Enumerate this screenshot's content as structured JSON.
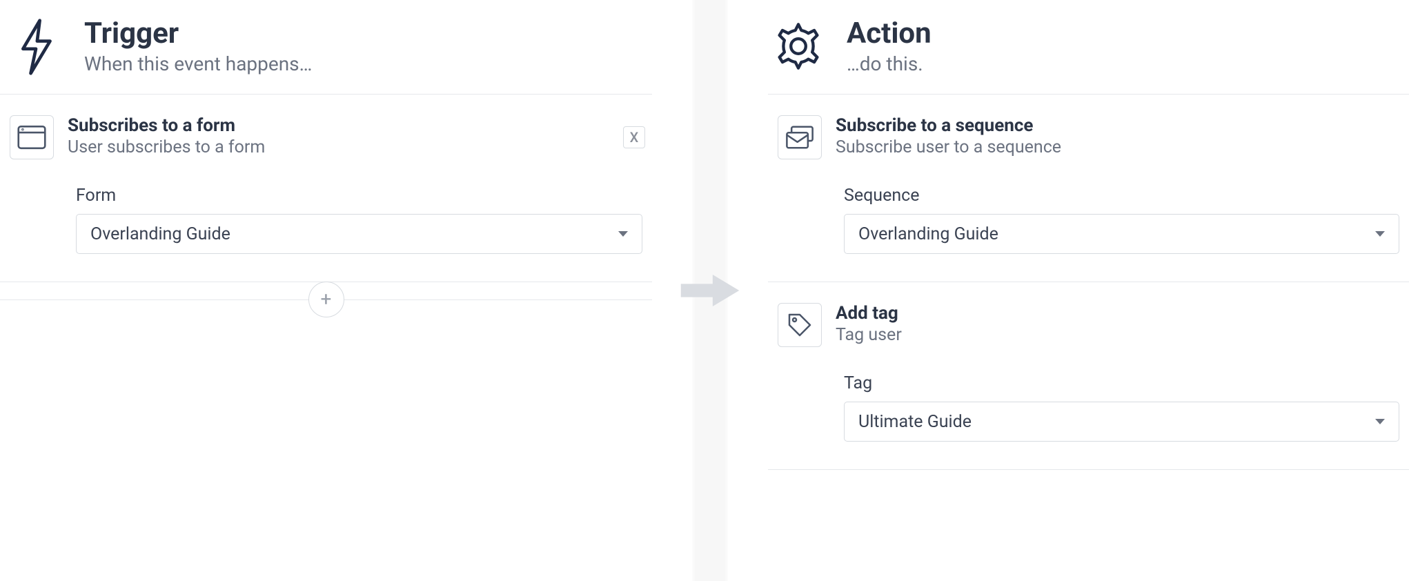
{
  "trigger": {
    "title": "Trigger",
    "subtitle": "When this event happens…",
    "card": {
      "title": "Subscribes to a form",
      "subtitle": "User subscribes to a form",
      "close_label": "X",
      "field_label": "Form",
      "field_value": "Overlanding Guide"
    },
    "add_label": "+"
  },
  "action": {
    "title": "Action",
    "subtitle": "…do this.",
    "cards": [
      {
        "title": "Subscribe to a sequence",
        "subtitle": "Subscribe user to a sequence",
        "field_label": "Sequence",
        "field_value": "Overlanding Guide"
      },
      {
        "title": "Add tag",
        "subtitle": "Tag user",
        "field_label": "Tag",
        "field_value": "Ultimate Guide"
      }
    ]
  },
  "colors": {
    "navy": "#1f2a44",
    "grey_text": "#6b7280",
    "grey_border": "#d7dbe0"
  }
}
